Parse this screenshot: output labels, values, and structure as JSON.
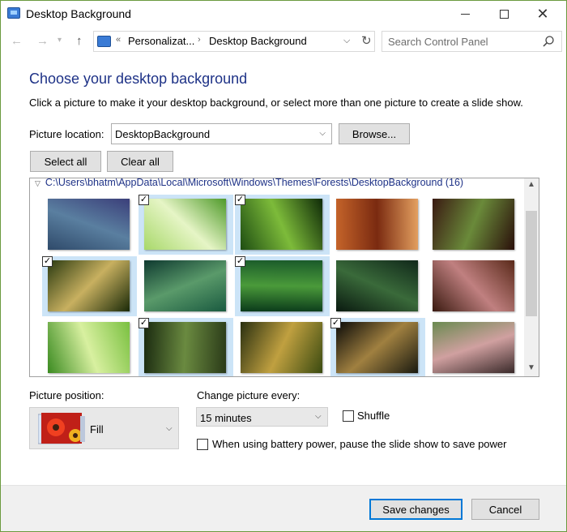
{
  "window": {
    "title": "Desktop Background"
  },
  "navigation": {
    "back": "←",
    "forward": "→",
    "up": "↑",
    "breadcrumb": [
      "Personalizat...",
      "Desktop Background"
    ],
    "search_placeholder": "Search Control Panel"
  },
  "main": {
    "heading": "Choose your desktop background",
    "description": "Click a picture to make it your desktop background, or select more than one picture to create a slide show.",
    "picture_location_label": "Picture location:",
    "picture_location_value": "DesktopBackground",
    "browse_label": "Browse...",
    "select_all_label": "Select all",
    "clear_all_label": "Clear all"
  },
  "gallery": {
    "path": "C:\\Users\\bhatm\\AppData\\Local\\Microsoft\\Windows\\Themes\\Forests\\DesktopBackground (16)",
    "check_mark": "✓",
    "images": [
      {
        "name": "forest-1",
        "selected": false,
        "colors": [
          "#2f4a6a",
          "#5a7fa0",
          "#3b3f7a"
        ]
      },
      {
        "name": "forest-2",
        "selected": true,
        "colors": [
          "#a8d86a",
          "#e6f5c6",
          "#4f9a2a"
        ]
      },
      {
        "name": "forest-3",
        "selected": true,
        "colors": [
          "#1e4d12",
          "#7dbb3a",
          "#0f2a08"
        ]
      },
      {
        "name": "forest-4",
        "selected": false,
        "colors": [
          "#c5642a",
          "#7a2a10",
          "#e4a060"
        ]
      },
      {
        "name": "forest-5",
        "selected": false,
        "colors": [
          "#3a1a12",
          "#6a8a3a",
          "#2a0f0a"
        ]
      },
      {
        "name": "forest-6",
        "selected": true,
        "colors": [
          "#2a3a10",
          "#c8b060",
          "#1a2a08"
        ]
      },
      {
        "name": "forest-7",
        "selected": false,
        "colors": [
          "#0f3a30",
          "#5a9a6a",
          "#1a5a40"
        ]
      },
      {
        "name": "forest-8",
        "selected": true,
        "colors": [
          "#1a5a2a",
          "#4a9a3a",
          "#0a3a1a"
        ]
      },
      {
        "name": "forest-9",
        "selected": false,
        "colors": [
          "#10281a",
          "#3a6a3a",
          "#0a1a10"
        ]
      },
      {
        "name": "forest-10",
        "selected": false,
        "colors": [
          "#5a2a1a",
          "#c08080",
          "#3a1a10"
        ]
      },
      {
        "name": "forest-11",
        "selected": false,
        "colors": [
          "#7ac040",
          "#d8f0a0",
          "#3a8a20"
        ]
      },
      {
        "name": "forest-12",
        "selected": true,
        "colors": [
          "#2a3a18",
          "#6a8a40",
          "#1a2a10"
        ]
      },
      {
        "name": "forest-13",
        "selected": false,
        "colors": [
          "#3a4a10",
          "#c0a040",
          "#2a3010"
        ]
      },
      {
        "name": "forest-14",
        "selected": true,
        "colors": [
          "#1a1a10",
          "#a08040",
          "#0a0a08"
        ]
      },
      {
        "name": "forest-15",
        "selected": false,
        "colors": [
          "#3a2a2a",
          "#d0a0a0",
          "#6a8a50"
        ]
      }
    ]
  },
  "options": {
    "picture_position_label": "Picture position:",
    "picture_position_value": "Fill",
    "change_every_label": "Change picture every:",
    "change_every_value": "15 minutes",
    "shuffle_label": "Shuffle",
    "battery_label": "When using battery power, pause the slide show to save power"
  },
  "footer": {
    "save_label": "Save changes",
    "cancel_label": "Cancel"
  }
}
